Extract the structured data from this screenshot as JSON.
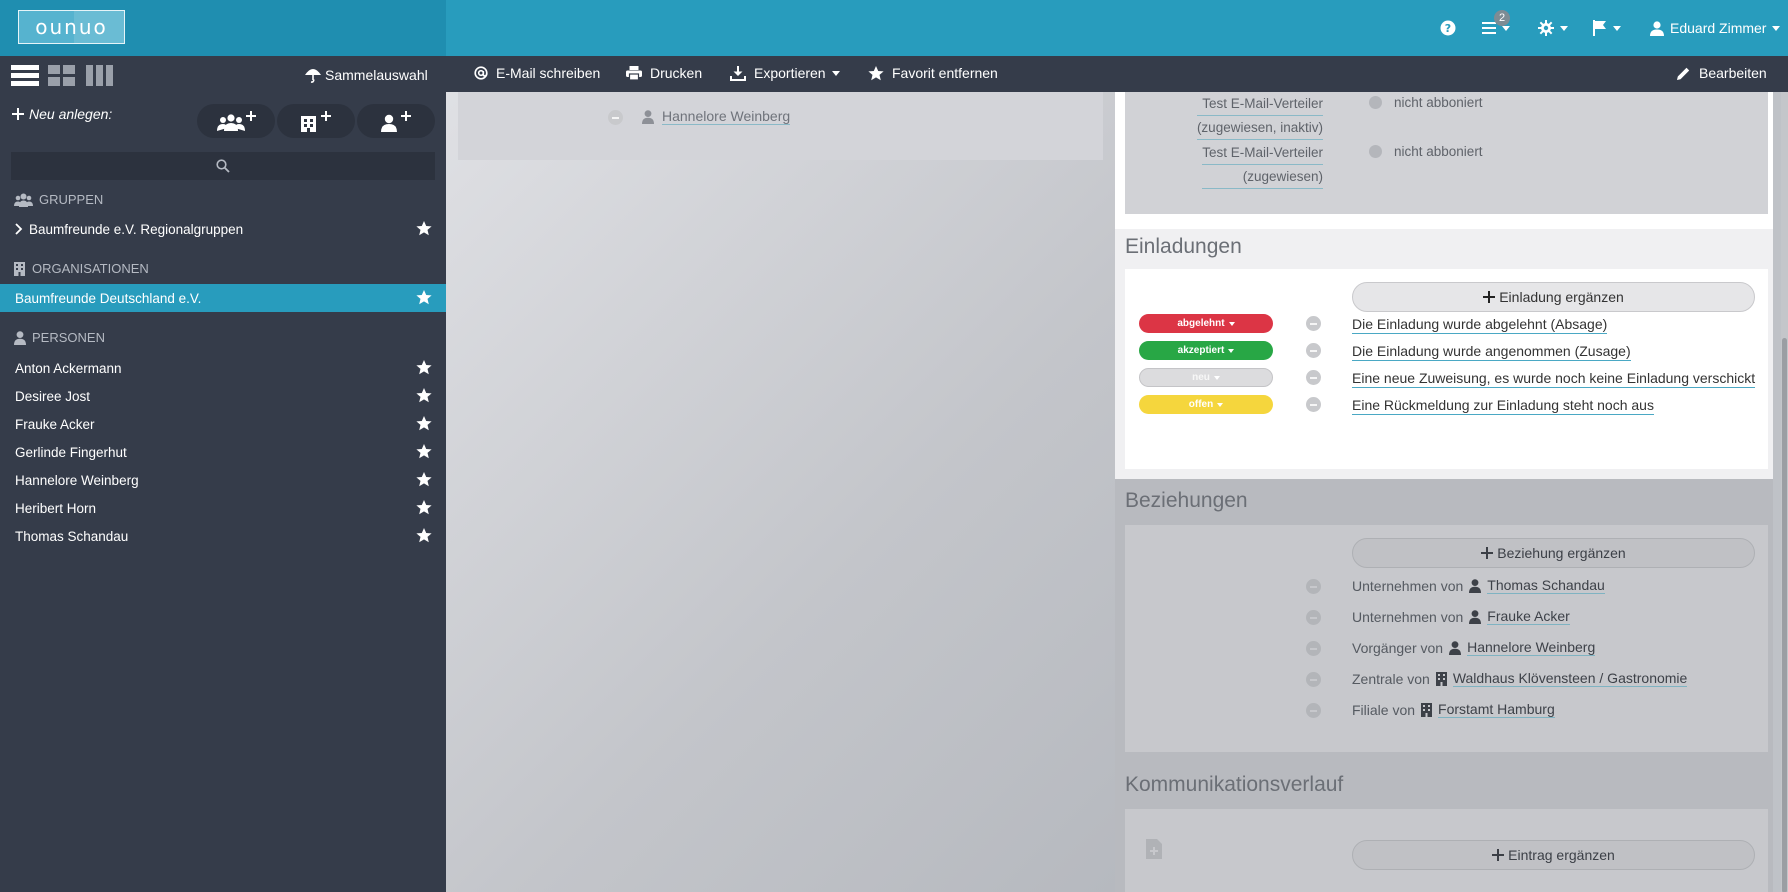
{
  "app": {
    "logo_text": "ounuo",
    "help_icon": "question-circle-icon",
    "tasks_badge": "2",
    "user_name": "Eduard Zimmer"
  },
  "toolbar": {
    "sammelauswahl": "Sammelauswahl",
    "email": "E-Mail schreiben",
    "print": "Drucken",
    "export": "Exportieren",
    "favorite": "Favorit entfernen",
    "edit": "Bearbeiten"
  },
  "sidebar": {
    "new_label": "Neu anlegen:",
    "groups_header": "GRUPPEN",
    "groups": [
      {
        "label": "Baumfreunde e.V. Regionalgruppen"
      }
    ],
    "orgs_header": "ORGANISATIONEN",
    "orgs": [
      {
        "label": "Baumfreunde Deutschland e.V.",
        "active": true
      }
    ],
    "persons_header": "PERSONEN",
    "persons": [
      {
        "label": "Anton Ackermann"
      },
      {
        "label": "Desiree Jost"
      },
      {
        "label": "Frauke Acker"
      },
      {
        "label": "Gerlinde Fingerhut"
      },
      {
        "label": "Hannelore Weinberg"
      },
      {
        "label": "Heribert Horn"
      },
      {
        "label": "Thomas Schandau"
      }
    ]
  },
  "middle": {
    "person": "Hannelore Weinberg"
  },
  "distribution": [
    {
      "label_line1": "Test E-Mail-Verteiler",
      "label_line2": "(zugewiesen, inaktiv)",
      "status": "nicht abboniert"
    },
    {
      "label_line1": "Test E-Mail-Verteiler",
      "label_line2": "(zugewiesen)",
      "status": "nicht abboniert"
    }
  ],
  "invitations": {
    "title": "Einladungen",
    "add_label": "Einladung ergänzen",
    "items": [
      {
        "status": "abgelehnt",
        "color": "#dc3545",
        "text": "Die Einladung wurde abgelehnt (Absage)"
      },
      {
        "status": "akzeptiert",
        "color": "#28a745",
        "text": "Die Einladung wurde angenommen (Zusage)"
      },
      {
        "status": "neu",
        "color": "#dcdcde",
        "text": "Eine neue Zuweisung, es wurde noch keine Einladung verschickt"
      },
      {
        "status": "offen",
        "color": "#f5d63d",
        "text": "Eine Rückmeldung zur Einladung steht noch aus"
      }
    ]
  },
  "relations": {
    "title": "Beziehungen",
    "add_label": "Beziehung ergänzen",
    "items": [
      {
        "prefix": "Unternehmen von",
        "icon": "person-icon",
        "name": "Thomas Schandau"
      },
      {
        "prefix": "Unternehmen von",
        "icon": "person-icon",
        "name": "Frauke Acker"
      },
      {
        "prefix": "Vorgänger von",
        "icon": "person-icon",
        "name": "Hannelore Weinberg"
      },
      {
        "prefix": "Zentrale von",
        "icon": "building-icon",
        "name": "Waldhaus Klövensteen / Gastronomie"
      },
      {
        "prefix": "Filiale von",
        "icon": "building-icon",
        "name": "Forstamt Hamburg"
      }
    ]
  },
  "communication": {
    "title": "Kommunikationsverlauf",
    "add_label": "Eintrag ergänzen"
  },
  "colors": {
    "brand": "#289cbd",
    "sidebar_bg": "#353c4a"
  }
}
